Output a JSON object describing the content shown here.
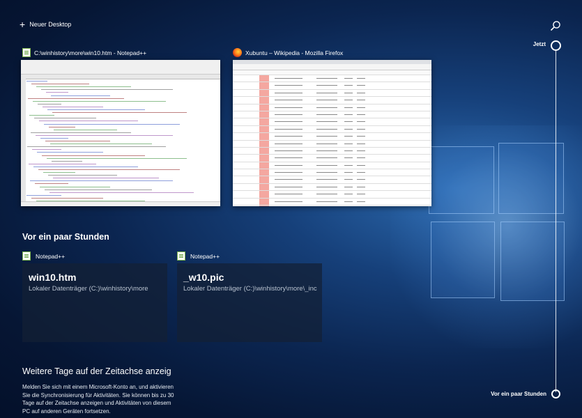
{
  "header": {
    "new_desktop_label": "Neuer Desktop",
    "search_icon": "search-icon"
  },
  "timeline": {
    "now_label": "Jetzt",
    "hours_label": "Vor ein paar Stunden"
  },
  "windows": [
    {
      "title": "C:\\winhistory\\more\\win10.htm - Notepad++",
      "icon": "notepad-plus-plus-icon"
    },
    {
      "title": "Xubuntu – Wikipedia - Mozilla Firefox",
      "icon": "firefox-icon"
    }
  ],
  "section": {
    "title": "Vor ein paar Stunden"
  },
  "activities": [
    {
      "app": "Notepad++",
      "title": "win10.htm",
      "path": "Lokaler Datenträger (C:)\\winhistory\\more"
    },
    {
      "app": "Notepad++",
      "title": "_w10.pic",
      "path": "Lokaler Datenträger (C:)\\winhistory\\more\\_inc"
    }
  ],
  "more": {
    "title": "Weitere Tage auf der Zeitachse anzeig",
    "text": "Melden Sie sich mit einem Microsoft-Konto an, und aktivieren Sie die Synchronisierung für Aktivitäten. Sie können bis zu 30 Tage auf der Zeitachse anzeigen und Aktivitäten von diesem PC auf anderen Geräten fortsetzen."
  },
  "colors": {
    "accent": "#ffffff",
    "card_bg": "#142034",
    "path_text": "#b8c2cf"
  }
}
